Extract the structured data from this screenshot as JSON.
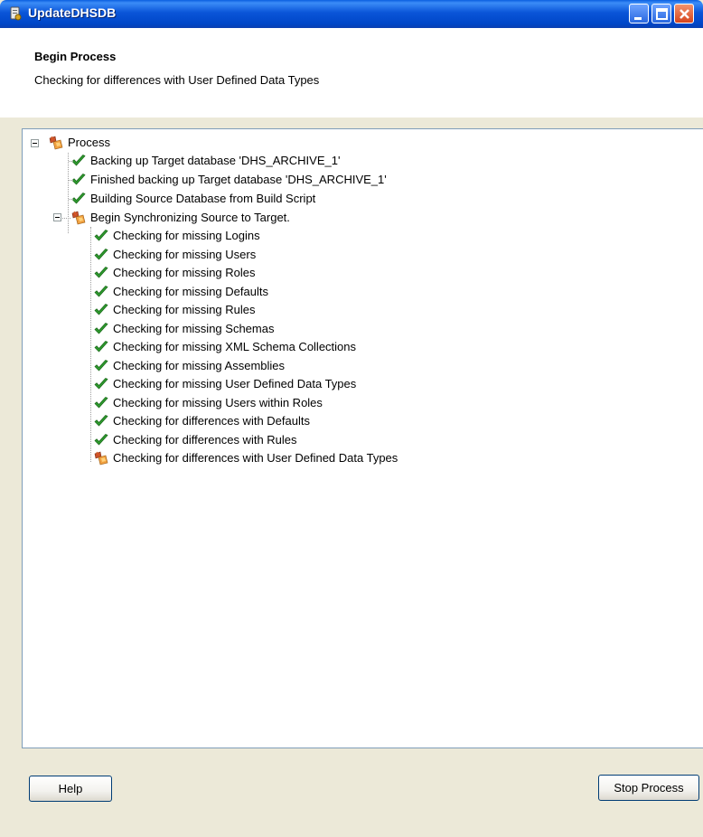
{
  "window": {
    "title": "UpdateDHSDB"
  },
  "header": {
    "title": "Begin Process",
    "subtitle": "Checking for differences with User Defined Data Types"
  },
  "tree": {
    "root": {
      "label": "Process",
      "status": "in-progress"
    },
    "items": [
      {
        "label": "Backing up Target database 'DHS_ARCHIVE_1'",
        "status": "done"
      },
      {
        "label": "Finished backing up Target database 'DHS_ARCHIVE_1'",
        "status": "done"
      },
      {
        "label": "Building Source Database from Build Script",
        "status": "done"
      },
      {
        "label": "Begin Synchronizing Source to Target.",
        "status": "in-progress"
      }
    ],
    "sync_items": [
      {
        "label": "Checking for missing Logins",
        "status": "done"
      },
      {
        "label": "Checking for missing Users",
        "status": "done"
      },
      {
        "label": "Checking for missing Roles",
        "status": "done"
      },
      {
        "label": "Checking for missing Defaults",
        "status": "done"
      },
      {
        "label": "Checking for missing Rules",
        "status": "done"
      },
      {
        "label": "Checking for missing Schemas",
        "status": "done"
      },
      {
        "label": "Checking for missing XML Schema Collections",
        "status": "done"
      },
      {
        "label": "Checking for missing Assemblies",
        "status": "done"
      },
      {
        "label": "Checking for missing User Defined Data Types",
        "status": "done"
      },
      {
        "label": "Checking for missing Users within Roles",
        "status": "done"
      },
      {
        "label": "Checking for differences with Defaults",
        "status": "done"
      },
      {
        "label": "Checking for differences with Rules",
        "status": "done"
      },
      {
        "label": "Checking for differences with User Defined Data Types",
        "status": "in-progress"
      }
    ]
  },
  "buttons": {
    "help": "Help",
    "stop": "Stop Process"
  },
  "icons": {
    "done": "green-check-icon",
    "in-progress": "running-process-icon"
  },
  "colors": {
    "titlebar": "#0a55d8",
    "check": "#2e9b2e",
    "dialog_bg": "#ece9d8"
  }
}
